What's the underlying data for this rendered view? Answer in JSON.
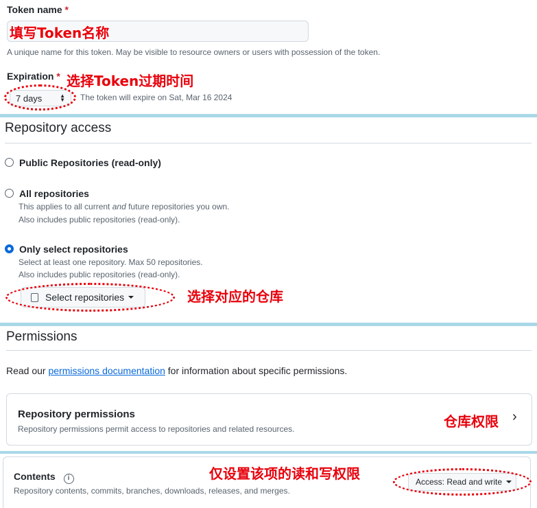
{
  "token": {
    "label": "Token name",
    "required_mark": "*",
    "annotation": "填写Token名称",
    "hint": "A unique name for this token. May be visible to resource owners or users with possession of the token."
  },
  "expiration": {
    "label": "Expiration",
    "required_mark": "*",
    "annotation": "选择Token过期时间",
    "selected": "7 days",
    "note": "The token will expire on Sat, Mar 16 2024"
  },
  "repository_access": {
    "heading": "Repository access",
    "options": [
      {
        "title": "Public Repositories (read-only)",
        "desc1": "",
        "desc2": ""
      },
      {
        "title": "All repositories",
        "desc1_pre": "This applies to all current ",
        "desc1_em": "and",
        "desc1_post": " future repositories you own.",
        "desc2": "Also includes public repositories (read-only)."
      },
      {
        "title": "Only select repositories",
        "desc1": "Select at least one repository. Max 50 repositories.",
        "desc2": "Also includes public repositories (read-only)."
      }
    ],
    "select_button": "Select repositories",
    "annotation": "选择对应的仓库"
  },
  "permissions": {
    "heading": "Permissions",
    "intro_pre": "Read our ",
    "intro_link": "permissions documentation",
    "intro_post": " for information about specific permissions.",
    "repo_card": {
      "title": "Repository permissions",
      "desc": "Repository permissions permit access to repositories and related resources.",
      "annotation": "仓库权限"
    },
    "contents": {
      "title": "Contents",
      "desc": "Repository contents, commits, branches, downloads, releases, and merges.",
      "access_button": "Access: Read and write",
      "annotation": "仅设置该项的读和写权限"
    }
  },
  "colors": {
    "accent": "#0969da",
    "annotation_red": "#e8000b",
    "band": "#a8d8e8"
  }
}
